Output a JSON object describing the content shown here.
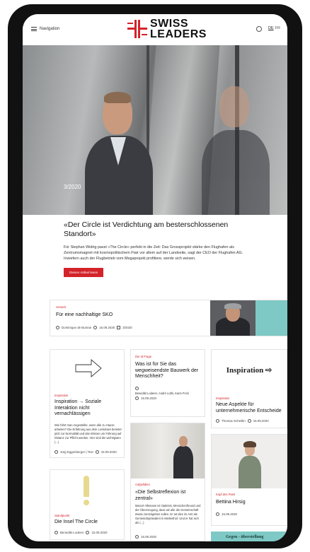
{
  "header": {
    "nav_label": "Navigation",
    "logo_line1": "SWISS",
    "logo_line2": "LEADERS",
    "lang_de": "DE",
    "lang_fr": "FR"
  },
  "hero": {
    "issue": "3/2020"
  },
  "lead": {
    "title": "«Der Circle ist Verdichtung am besterschlossenen Standort»",
    "body": "Für Stephan Widrig passt «The Circle» perfekt in die Zeit: Das Grossprojekt stärke den Flughafen als Zentrumsmagnet mit kosmopolitischem Flair vor allem auf der Landseite, sagt der CEO der Flughafen AG. Inwiefern auch der Flugbetrieb vom Megaprojekt profitiere, werde sich weisen.",
    "button": "Diesen Artikel lesen"
  },
  "feature": {
    "kicker": "Verwelt",
    "title": "Für eine nachhaltige SKO",
    "author": "Dominique de Buman",
    "date": "15.09.2020",
    "issue": "3/2020"
  },
  "cards": {
    "inspiration": {
      "kicker": "Inspiration",
      "title": "Inspiration → Soziale Interaktion nicht vernachlässigen",
      "text": "Wie führt man Angestellte, wenn alle zu Hause arbeiten? Die Erfahrung aus dem Lockdown bereitet jetzt zur Normalität und das Wissen um Führung auf Distanz zur Pflicht werden. Hier sind die wichtigsten (...)",
      "author": "Jürg Eggenberger | Text",
      "date": "15.09.2020"
    },
    "frage": {
      "kicker": "Die Id Frage",
      "title": "Was ist für Sie das wegweisendste Bauwerk der Menschheit?",
      "author": "Benedikt Loderer, André Lüthi, Karin Frick",
      "date": "15.09.2020"
    },
    "aspekte": {
      "logo": "Inspiration ⇨",
      "kicker": "Inspiration",
      "title": "Neue Aspekte für unternehmerische Entscheide",
      "author": "Thomas Scheitlin",
      "date": "15.09.2020"
    },
    "selbst": {
      "kicker": "Aufgefallen",
      "title": "«Die Selbstreflexion ist zentral»",
      "text": "Marcel Allemann ist Optimist, Menschenfreund und der Überzeugung, dass wir alle die Gemeinschaft etwas zurückgeben sollen. Er tut dies im Amt als Gemeindepräsident in Meilenthof. Und er hat sich als (...)",
      "date": "15.09.2020"
    },
    "bettina": {
      "kicker": "Kopf des Paris",
      "title": "Bettina Hirsig",
      "date": "15.09.2020"
    },
    "insel": {
      "kicker": "Standpunkt",
      "title": "Die Insel The Circle",
      "author": "Benedikt Loderer",
      "date": "15.09.2020"
    },
    "teaser": {
      "label": "Gegen - überstellung"
    }
  },
  "colors": {
    "accent": "#d3232a",
    "teal": "#7ec9c5"
  },
  "icons": [
    "hamburger-icon",
    "search-icon",
    "author-icon",
    "clock-icon",
    "issue-icon",
    "arrow-right-icon",
    "exclamation-icon"
  ]
}
